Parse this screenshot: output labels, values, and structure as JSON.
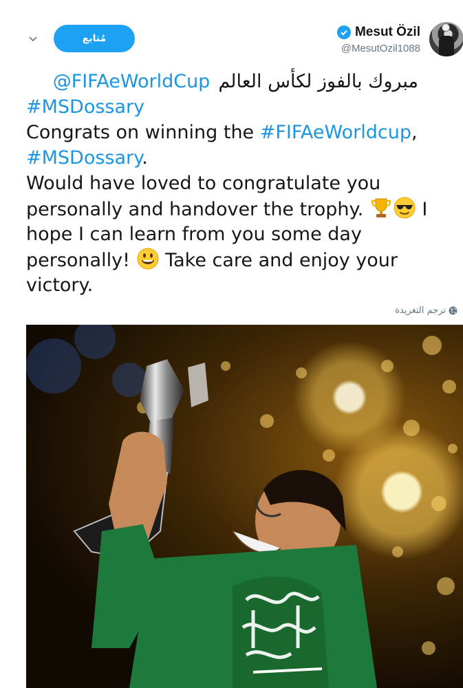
{
  "author": {
    "display_name": "Mesut Özil",
    "handle": "@MesutOzil1088",
    "verified_icon": "verified-badge-icon",
    "avatar_icon": "avatar"
  },
  "actions": {
    "follow_label": "مُتابع",
    "caret_icon": "chevron-down-icon"
  },
  "tweet": {
    "arabic_text": "مبروك بالفوز لكأس العالم",
    "mention": "@FIFAeWorldCup",
    "hashtag_dossary": "#MSDossary",
    "line3_text": "Congrats on winning the ",
    "hashtag_fifa": "#FIFAeWorldcup",
    "line3_end": ",",
    "line4_end": ".",
    "line5": "Would have loved to congratulate you",
    "line6": "personally and handover the trophy.",
    "line6_end": "I",
    "line7": "hope I can learn from you some day",
    "line8_start": "personally!",
    "line8_end": "Take care and enjoy your",
    "line9": "victory.",
    "emojis": [
      "trophy-icon",
      "sunglasses-face-icon",
      "smiley-face-icon"
    ]
  },
  "translate": {
    "label": "ترجم التغريدة",
    "icon": "globe-icon"
  },
  "colors": {
    "accent": "#1da1f2",
    "link": "#1b95e0",
    "text": "#14171a",
    "secondary": "#657786",
    "flag_green": "#1e7a3c"
  }
}
